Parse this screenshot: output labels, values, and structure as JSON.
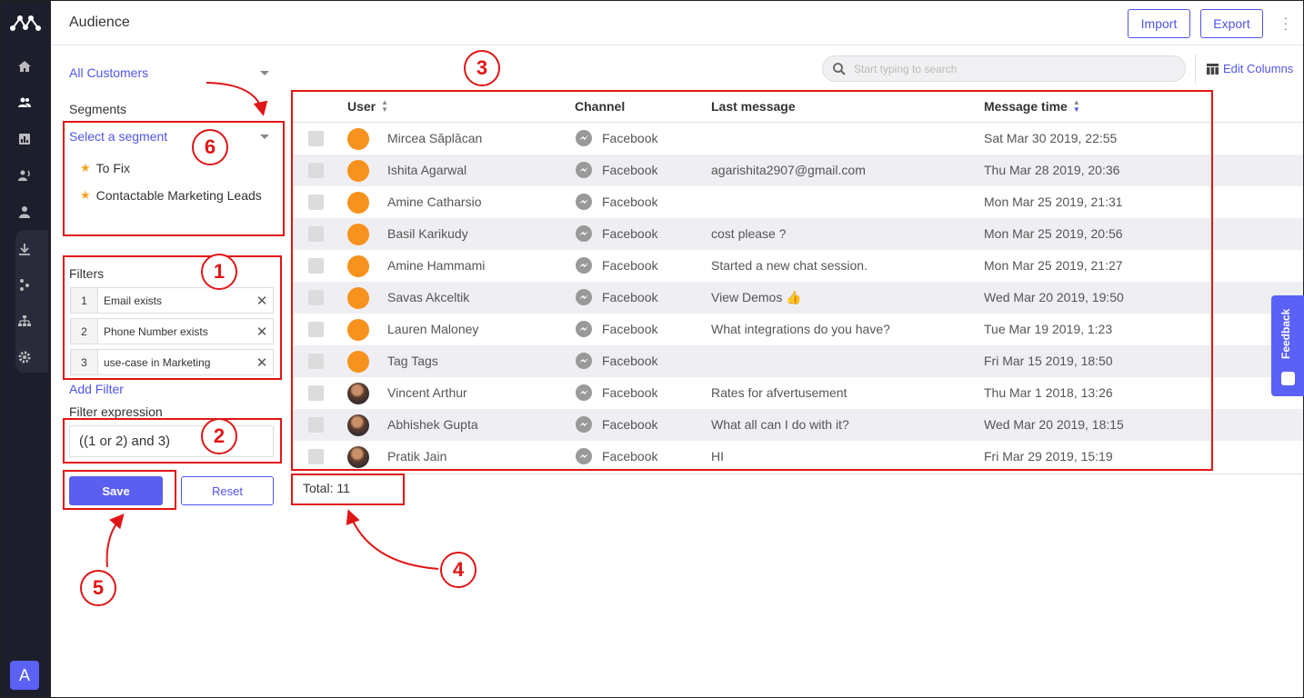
{
  "header": {
    "title": "Audience",
    "import_label": "Import",
    "export_label": "Export"
  },
  "sidebar": {
    "avatar_letter": "A"
  },
  "left_panel": {
    "customer_select": "All Customers",
    "segments_heading": "Segments",
    "segment_placeholder": "Select a segment",
    "segments": [
      "To Fix",
      "Contactable Marketing Leads"
    ],
    "filters_heading": "Filters",
    "filters": [
      {
        "num": "1",
        "label": "Email exists"
      },
      {
        "num": "2",
        "label": "Phone Number exists"
      },
      {
        "num": "3",
        "label": "use-case in Marketing"
      }
    ],
    "add_filter": "Add Filter",
    "expression_heading": "Filter expression",
    "expression": "((1 or 2) and 3)",
    "save": "Save",
    "reset": "Reset"
  },
  "main": {
    "search_placeholder": "Start typing to search",
    "edit_columns": "Edit Columns",
    "columns": [
      "User",
      "Channel",
      "Last message",
      "Message time"
    ],
    "rows": [
      {
        "name": "Mircea Săplăcan",
        "channel": "Facebook",
        "last": "",
        "time": "Sat Mar 30 2019, 22:55",
        "photo": false
      },
      {
        "name": "Ishita Agarwal",
        "channel": "Facebook",
        "last": "agarishita2907@gmail.com",
        "time": "Thu Mar 28 2019, 20:36",
        "photo": false
      },
      {
        "name": "Amine Catharsio",
        "channel": "Facebook",
        "last": "",
        "time": "Mon Mar 25 2019, 21:31",
        "photo": false
      },
      {
        "name": "Basil Karikudy",
        "channel": "Facebook",
        "last": "cost please ?",
        "time": "Mon Mar 25 2019, 20:56",
        "photo": false
      },
      {
        "name": "Amine Hammami",
        "channel": "Facebook",
        "last": "Started a new chat session.",
        "time": "Mon Mar 25 2019, 21:27",
        "photo": false
      },
      {
        "name": "Savas Akceltik",
        "channel": "Facebook",
        "last": "View Demos 👍",
        "time": "Wed Mar 20 2019, 19:50",
        "photo": false
      },
      {
        "name": "Lauren Maloney",
        "channel": "Facebook",
        "last": "What integrations do you have?",
        "time": "Tue Mar 19 2019, 1:23",
        "photo": false
      },
      {
        "name": "Tag Tags",
        "channel": "Facebook",
        "last": "",
        "time": "Fri Mar 15 2019, 18:50",
        "photo": false
      },
      {
        "name": "Vincent Arthur",
        "channel": "Facebook",
        "last": "Rates for afvertusement",
        "time": "Thu Mar 1 2018, 13:26",
        "photo": true
      },
      {
        "name": "Abhishek Gupta",
        "channel": "Facebook",
        "last": "What all can I do with it?",
        "time": "Wed Mar 20 2019, 18:15",
        "photo": true
      },
      {
        "name": "Pratik Jain",
        "channel": "Facebook",
        "last": "HI",
        "time": "Fri Mar 29 2019, 15:19",
        "photo": true
      }
    ],
    "total": "Total: 11"
  },
  "feedback_tab": "Feedback",
  "annotations": [
    "1",
    "2",
    "3",
    "4",
    "5",
    "6"
  ],
  "colors": {
    "accent": "#4f55e8",
    "rail": "#1d1e2c",
    "annotation": "#e01616",
    "avatar": "#f7921e"
  }
}
